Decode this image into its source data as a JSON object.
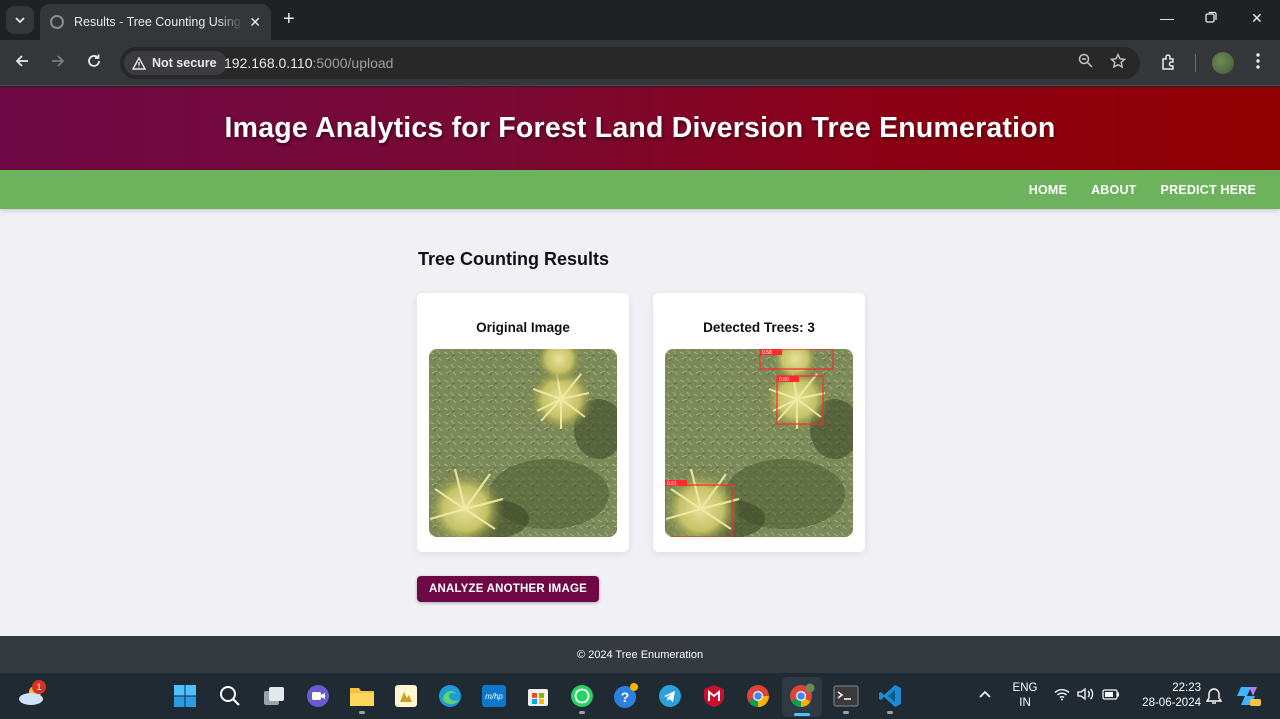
{
  "browser": {
    "tab_title": "Results - Tree Counting Using S",
    "security_label": "Not secure",
    "url_host": "192.168.0.110",
    "url_rest": ":5000/upload"
  },
  "site": {
    "banner_title": "Image Analytics for Forest Land Diversion Tree Enumeration",
    "nav": [
      "HOME",
      "ABOUT",
      "PREDICT HERE"
    ]
  },
  "results": {
    "heading": "Tree Counting Results",
    "original_caption": "Original Image",
    "detected_label": "Detected Trees: ",
    "detected_count": "3",
    "detections": [
      {
        "label": "0.58"
      },
      {
        "label": "0.60"
      },
      {
        "label": "0.61"
      }
    ],
    "analyze_button": "ANALYZE ANOTHER IMAGE"
  },
  "footer": {
    "text": "© 2024 Tree Enumeration"
  },
  "taskbar": {
    "weather_badge": "1",
    "lang_line1": "ENG",
    "lang_line2": "IN",
    "time": "22:23",
    "date": "28-06-2024",
    "icons": [
      "start-icon",
      "search-icon",
      "task-view-icon",
      "meet-icon",
      "file-explorer-icon",
      "app-icon",
      "edge-icon",
      "mhp-icon",
      "store-icon",
      "whatsapp-icon",
      "help-icon",
      "telegram-icon",
      "mcafee-icon",
      "chrome-icon",
      "chrome-profile-icon",
      "terminal-icon",
      "vscode-icon"
    ]
  },
  "colors": {
    "banner_start": "#6e0945",
    "banner_end": "#8f0000",
    "nav_green": "#6db35d",
    "button": "#6e0945",
    "footer": "#343a40",
    "box_red": "#ff2a2a"
  }
}
